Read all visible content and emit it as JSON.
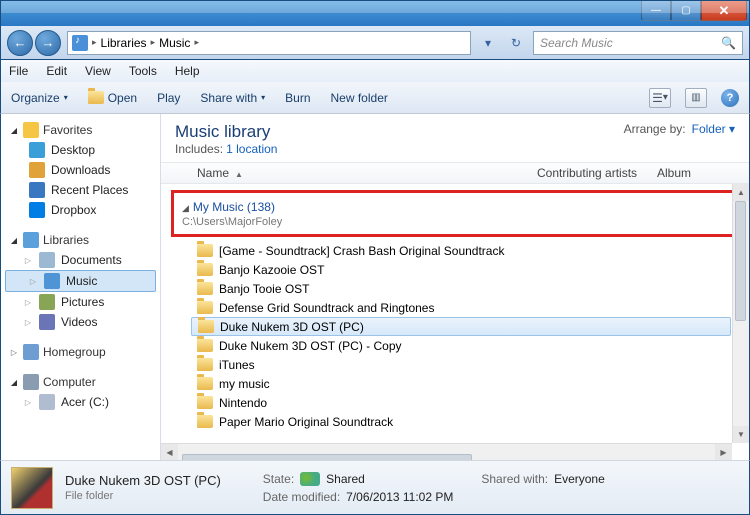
{
  "titlebar": {
    "min": "—",
    "max": "▢",
    "close": "✕"
  },
  "nav": {
    "breadcrumb": [
      "Libraries",
      "Music"
    ],
    "refresh_glyph": "↻",
    "search_placeholder": "Search Music",
    "search_glyph": "🔍"
  },
  "menubar": [
    "File",
    "Edit",
    "View",
    "Tools",
    "Help"
  ],
  "toolbar": {
    "organize": "Organize",
    "open": "Open",
    "play": "Play",
    "share": "Share with",
    "burn": "Burn",
    "newfolder": "New folder",
    "view_glyph": "☰",
    "preview_glyph": "▥",
    "help_glyph": "?"
  },
  "navpane": {
    "favorites": {
      "label": "Favorites",
      "items": [
        "Desktop",
        "Downloads",
        "Recent Places",
        "Dropbox"
      ]
    },
    "libraries": {
      "label": "Libraries",
      "items": [
        "Documents",
        "Music",
        "Pictures",
        "Videos"
      ],
      "selected": "Music"
    },
    "homegroup": {
      "label": "Homegroup"
    },
    "computer": {
      "label": "Computer",
      "items": [
        "Acer (C:)"
      ]
    }
  },
  "content": {
    "library_title": "Music library",
    "includes_label": "Includes:",
    "includes_link": "1 location",
    "arrange_label": "Arrange by:",
    "arrange_value": "Folder",
    "columns": {
      "name": "Name",
      "artists": "Contributing artists",
      "album": "Album"
    },
    "group": {
      "title": "My Music (138)",
      "path": "C:\\Users\\MajorFoley"
    },
    "folders": [
      "[Game - Soundtrack] Crash Bash Original Soundtrack",
      "Banjo Kazooie OST",
      "Banjo Tooie OST",
      "Defense Grid Soundtrack and Ringtones",
      "Duke Nukem 3D OST (PC)",
      "Duke Nukem 3D OST (PC) - Copy",
      "iTunes",
      "my  music",
      "Nintendo",
      "Paper Mario Original Soundtrack"
    ],
    "selected_index": 4
  },
  "details": {
    "name": "Duke Nukem 3D OST (PC)",
    "type": "File folder",
    "state_label": "State:",
    "state_value": "Shared",
    "shared_label": "Shared with:",
    "shared_value": "Everyone",
    "modified_label": "Date modified:",
    "modified_value": "7/06/2013 11:02 PM"
  }
}
